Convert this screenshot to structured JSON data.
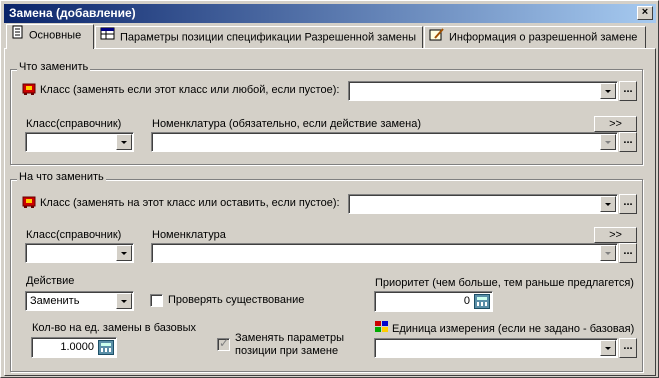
{
  "window": {
    "title": "Замена (добавление)",
    "close_glyph": "×"
  },
  "tabs": [
    {
      "label": "Основные",
      "icon": "general-tab-icon"
    },
    {
      "label": "Параметры позиции спецификации Разрешенной замены",
      "icon": "table-icon"
    },
    {
      "label": "Информация о разрешенной замене",
      "icon": "info-edit-icon"
    }
  ],
  "what": {
    "group_label": "Что заменить",
    "class_label": "Класс (заменять если этот класс или любой, если пустое):",
    "class_value": "",
    "ref_class_label": "Класс(справочник)",
    "ref_class_value": "",
    "nomenclature_label": "Номенклатура (обязательно, если действие замена)",
    "nomenclature_value": "",
    "more_button": ">>"
  },
  "to": {
    "group_label": "На что заменить",
    "class_label": "Класс (заменять на этот класс или оставить, если пустое):",
    "class_value": "",
    "ref_class_label": "Класс(справочник)",
    "ref_class_value": "",
    "nomenclature_label": "Номенклатура",
    "nomenclature_value": "",
    "more_button": ">>",
    "action_label": "Действие",
    "action_value": "Заменить",
    "check_existence_label": "Проверять существование",
    "check_existence_checked": false,
    "priority_label": "Приоритет (чем больше, тем раньше предлагется)",
    "priority_value": "0",
    "qty_label": "Кол-во на ед. замены в базовых",
    "qty_value": "1.0000",
    "replace_params_label_line1": "Заменять параметры",
    "replace_params_label_line2": "позиции при замене",
    "replace_params_checked": true,
    "unit_label": "Единица измерения (если не задано - базовая)",
    "unit_value": ""
  },
  "ellipsis": "..."
}
